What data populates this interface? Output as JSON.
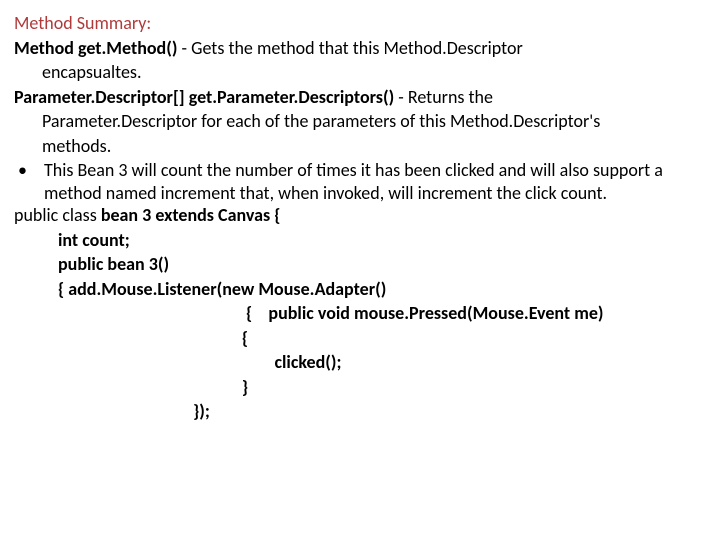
{
  "heading": "Method Summary:",
  "entry1": {
    "sig_type": "Method",
    "sig_name": "get.Method()",
    "desc_start": " -  Gets the method that this Method.Descriptor",
    "desc_cont": "encapsualtes."
  },
  "entry2": {
    "sig_type": "Parameter.Descriptor[]",
    "sig_name": "get.Parameter.Descriptors()",
    "desc_start": " -  Returns the",
    "desc_cont1": "Parameter.Descriptor for each of the parameters of this Method.Descriptor's",
    "desc_cont2": "methods."
  },
  "bullet": {
    "dot": "•",
    "text": "This Bean 3 will count the number of times it has been clicked and will also support a method named increment that, when invoked, will increment the click count."
  },
  "code": {
    "l1_prefix": "public class  ",
    "l1_bold": "bean 3 extends Canvas {",
    "l2": "int count;",
    "l3": "public  bean 3()",
    "l4_open": "{",
    "l4_body": "add.Mouse.Listener(new  Mouse.Adapter()",
    "l5": "{    public void mouse.Pressed(Mouse.Event me)",
    "l6": "{",
    "l7": "    clicked();",
    "l8": "}",
    "l9": "});"
  }
}
